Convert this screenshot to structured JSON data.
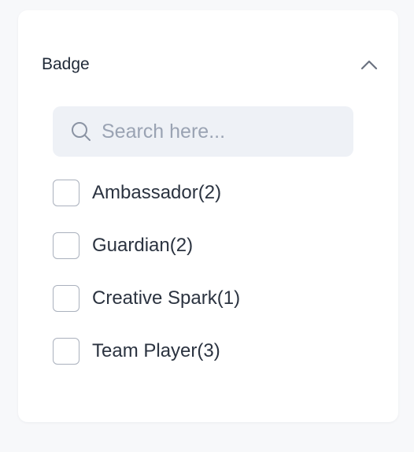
{
  "filter": {
    "title": "Badge",
    "search_placeholder": "Search here...",
    "options": [
      {
        "label": "Ambassador(2)",
        "checked": false
      },
      {
        "label": "Guardian(2)",
        "checked": false
      },
      {
        "label": "Creative Spark(1)",
        "checked": false
      },
      {
        "label": "Team Player(3)",
        "checked": false
      }
    ],
    "icons": {
      "collapse": "chevron-up-icon",
      "search": "search-icon"
    },
    "colors": {
      "search_bg": "#eef1f6",
      "checkbox_border": "#aab1bd",
      "placeholder": "#9aa3b3"
    }
  }
}
